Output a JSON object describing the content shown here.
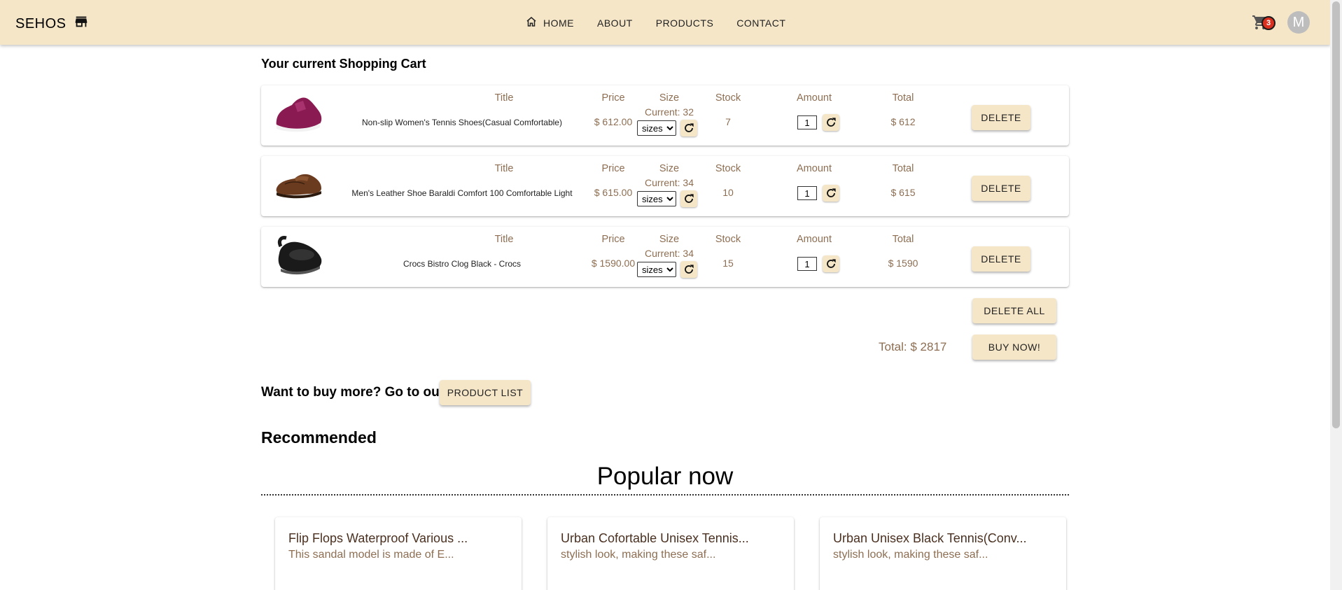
{
  "header": {
    "brand": "SEHOS",
    "nav": [
      "HOME",
      "ABOUT",
      "PRODUCTS",
      "CONTACT"
    ],
    "cart_count": "3",
    "avatar_letter": "M",
    "bg_color": "#f5e6c8"
  },
  "cart": {
    "title": "Your current Shopping Cart",
    "columns": {
      "title": "Title",
      "price": "Price",
      "size": "Size",
      "stock": "Stock",
      "amount": "Amount",
      "total": "Total"
    },
    "items": [
      {
        "title": "Non-slip Women's Tennis Shoes(Casual Comfortable)",
        "price": "$ 612.00",
        "size_current": "Current: 32",
        "size_select": "sizes",
        "stock": "7",
        "amount": "1",
        "total": "$ 612",
        "delete_label": "DELETE",
        "image": "magenta-sneaker"
      },
      {
        "title": "Men's Leather Shoe Baraldi Comfort 100 Comfortable Light",
        "price": "$ 615.00",
        "size_current": "Current: 34",
        "size_select": "sizes",
        "stock": "10",
        "amount": "1",
        "total": "$ 615",
        "delete_label": "DELETE",
        "image": "brown-leather-shoe"
      },
      {
        "title": "Crocs Bistro Clog Black - Crocs",
        "price": "$ 1590.00",
        "size_current": "Current: 34",
        "size_select": "sizes",
        "stock": "15",
        "amount": "1",
        "total": "$ 1590",
        "delete_label": "DELETE",
        "image": "black-clog"
      }
    ],
    "delete_all_label": "DELETE ALL",
    "grand_total": "Total: $ 2817",
    "buy_label": "BUY NOW!"
  },
  "more": {
    "text": "Want to buy more? Go to our",
    "button": "PRODUCT LIST"
  },
  "recommended": {
    "title": "Recommended",
    "popular_title": "Popular now",
    "cards": [
      {
        "title": "Flip Flops Waterproof Various ...",
        "desc": "This sandal model is made of E..."
      },
      {
        "title": "Urban Cofortable Unisex Tennis...",
        "desc": "stylish look, making these saf..."
      },
      {
        "title": "Urban Unisex Black Tennis(Conv...",
        "desc": "stylish look, making these saf..."
      }
    ]
  }
}
